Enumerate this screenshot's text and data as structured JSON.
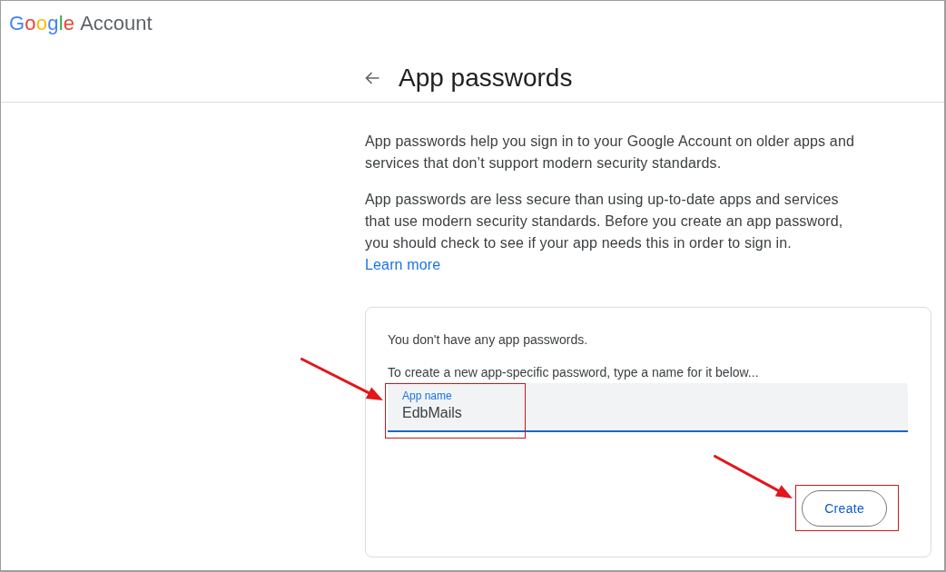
{
  "header": {
    "logo": {
      "wordmark": "Google",
      "product": "Account"
    },
    "title": "App passwords"
  },
  "intro": {
    "paragraphs": [
      "App passwords help you sign in to your Google Account on older apps and services that don’t support modern security standards.",
      "App passwords are less secure than using up-to-date apps and services that use modern security standards. Before you create an app password, you should check to see if your app needs this in order to sign in."
    ],
    "link": "Learn more"
  },
  "card": {
    "messages": [
      "You don't have any app passwords.",
      "To create a new app-specific password, type a name for it below..."
    ],
    "field": {
      "label": "App name",
      "value": "EdbMails",
      "focused": true,
      "highlighted": true
    },
    "button": {
      "label": "Create",
      "highlighted": true
    }
  }
}
